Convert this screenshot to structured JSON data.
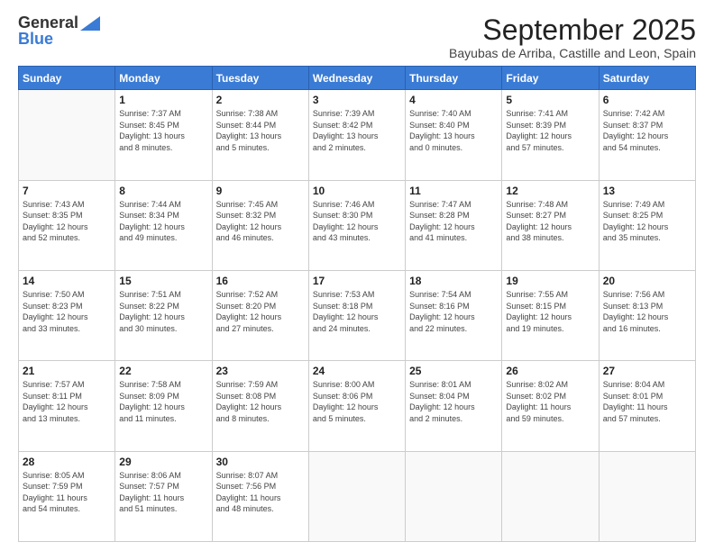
{
  "logo": {
    "general": "General",
    "blue": "Blue"
  },
  "title": "September 2025",
  "subtitle": "Bayubas de Arriba, Castille and Leon, Spain",
  "days_header": [
    "Sunday",
    "Monday",
    "Tuesday",
    "Wednesday",
    "Thursday",
    "Friday",
    "Saturday"
  ],
  "weeks": [
    [
      {
        "day": "",
        "info": ""
      },
      {
        "day": "1",
        "info": "Sunrise: 7:37 AM\nSunset: 8:45 PM\nDaylight: 13 hours\nand 8 minutes."
      },
      {
        "day": "2",
        "info": "Sunrise: 7:38 AM\nSunset: 8:44 PM\nDaylight: 13 hours\nand 5 minutes."
      },
      {
        "day": "3",
        "info": "Sunrise: 7:39 AM\nSunset: 8:42 PM\nDaylight: 13 hours\nand 2 minutes."
      },
      {
        "day": "4",
        "info": "Sunrise: 7:40 AM\nSunset: 8:40 PM\nDaylight: 13 hours\nand 0 minutes."
      },
      {
        "day": "5",
        "info": "Sunrise: 7:41 AM\nSunset: 8:39 PM\nDaylight: 12 hours\nand 57 minutes."
      },
      {
        "day": "6",
        "info": "Sunrise: 7:42 AM\nSunset: 8:37 PM\nDaylight: 12 hours\nand 54 minutes."
      }
    ],
    [
      {
        "day": "7",
        "info": "Sunrise: 7:43 AM\nSunset: 8:35 PM\nDaylight: 12 hours\nand 52 minutes."
      },
      {
        "day": "8",
        "info": "Sunrise: 7:44 AM\nSunset: 8:34 PM\nDaylight: 12 hours\nand 49 minutes."
      },
      {
        "day": "9",
        "info": "Sunrise: 7:45 AM\nSunset: 8:32 PM\nDaylight: 12 hours\nand 46 minutes."
      },
      {
        "day": "10",
        "info": "Sunrise: 7:46 AM\nSunset: 8:30 PM\nDaylight: 12 hours\nand 43 minutes."
      },
      {
        "day": "11",
        "info": "Sunrise: 7:47 AM\nSunset: 8:28 PM\nDaylight: 12 hours\nand 41 minutes."
      },
      {
        "day": "12",
        "info": "Sunrise: 7:48 AM\nSunset: 8:27 PM\nDaylight: 12 hours\nand 38 minutes."
      },
      {
        "day": "13",
        "info": "Sunrise: 7:49 AM\nSunset: 8:25 PM\nDaylight: 12 hours\nand 35 minutes."
      }
    ],
    [
      {
        "day": "14",
        "info": "Sunrise: 7:50 AM\nSunset: 8:23 PM\nDaylight: 12 hours\nand 33 minutes."
      },
      {
        "day": "15",
        "info": "Sunrise: 7:51 AM\nSunset: 8:22 PM\nDaylight: 12 hours\nand 30 minutes."
      },
      {
        "day": "16",
        "info": "Sunrise: 7:52 AM\nSunset: 8:20 PM\nDaylight: 12 hours\nand 27 minutes."
      },
      {
        "day": "17",
        "info": "Sunrise: 7:53 AM\nSunset: 8:18 PM\nDaylight: 12 hours\nand 24 minutes."
      },
      {
        "day": "18",
        "info": "Sunrise: 7:54 AM\nSunset: 8:16 PM\nDaylight: 12 hours\nand 22 minutes."
      },
      {
        "day": "19",
        "info": "Sunrise: 7:55 AM\nSunset: 8:15 PM\nDaylight: 12 hours\nand 19 minutes."
      },
      {
        "day": "20",
        "info": "Sunrise: 7:56 AM\nSunset: 8:13 PM\nDaylight: 12 hours\nand 16 minutes."
      }
    ],
    [
      {
        "day": "21",
        "info": "Sunrise: 7:57 AM\nSunset: 8:11 PM\nDaylight: 12 hours\nand 13 minutes."
      },
      {
        "day": "22",
        "info": "Sunrise: 7:58 AM\nSunset: 8:09 PM\nDaylight: 12 hours\nand 11 minutes."
      },
      {
        "day": "23",
        "info": "Sunrise: 7:59 AM\nSunset: 8:08 PM\nDaylight: 12 hours\nand 8 minutes."
      },
      {
        "day": "24",
        "info": "Sunrise: 8:00 AM\nSunset: 8:06 PM\nDaylight: 12 hours\nand 5 minutes."
      },
      {
        "day": "25",
        "info": "Sunrise: 8:01 AM\nSunset: 8:04 PM\nDaylight: 12 hours\nand 2 minutes."
      },
      {
        "day": "26",
        "info": "Sunrise: 8:02 AM\nSunset: 8:02 PM\nDaylight: 11 hours\nand 59 minutes."
      },
      {
        "day": "27",
        "info": "Sunrise: 8:04 AM\nSunset: 8:01 PM\nDaylight: 11 hours\nand 57 minutes."
      }
    ],
    [
      {
        "day": "28",
        "info": "Sunrise: 8:05 AM\nSunset: 7:59 PM\nDaylight: 11 hours\nand 54 minutes."
      },
      {
        "day": "29",
        "info": "Sunrise: 8:06 AM\nSunset: 7:57 PM\nDaylight: 11 hours\nand 51 minutes."
      },
      {
        "day": "30",
        "info": "Sunrise: 8:07 AM\nSunset: 7:56 PM\nDaylight: 11 hours\nand 48 minutes."
      },
      {
        "day": "",
        "info": ""
      },
      {
        "day": "",
        "info": ""
      },
      {
        "day": "",
        "info": ""
      },
      {
        "day": "",
        "info": ""
      }
    ]
  ]
}
